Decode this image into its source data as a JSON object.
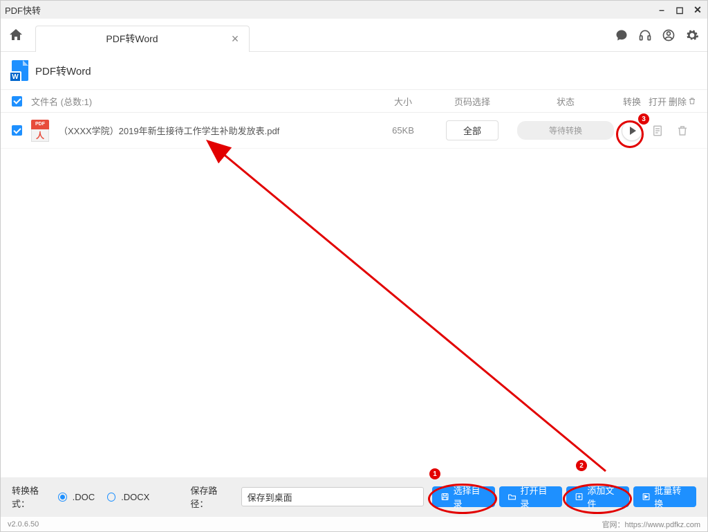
{
  "app_title": "PDF快转",
  "tab": {
    "label": "PDF转Word"
  },
  "heading": "PDF转Word",
  "doc_badge": "W",
  "columns": {
    "filename": "文件名 (总数:1)",
    "size": "大小",
    "pages": "页码选择",
    "status": "状态",
    "convert": "转换",
    "open": "打开",
    "delete": "删除"
  },
  "row": {
    "icon_label": "PDF",
    "filename": "（XXXX学院）2019年新生接待工作学生补助发放表.pdf",
    "size": "65KB",
    "page_button": "全部",
    "status": "等待转换"
  },
  "bottom": {
    "format_label": "转换格式：",
    "opt_doc": ".DOC",
    "opt_docx": ".DOCX",
    "path_label": "保存路径：",
    "path_value": "保存到桌面",
    "btn_choose": "选择目录",
    "btn_open": "打开目录",
    "btn_add": "添加文件",
    "btn_batch": "批量转换"
  },
  "status": {
    "version": "v2.0.6.50",
    "site": "官网：https://www.pdfkz.com"
  },
  "anno": {
    "n1": "1",
    "n2": "2",
    "n3": "3"
  }
}
